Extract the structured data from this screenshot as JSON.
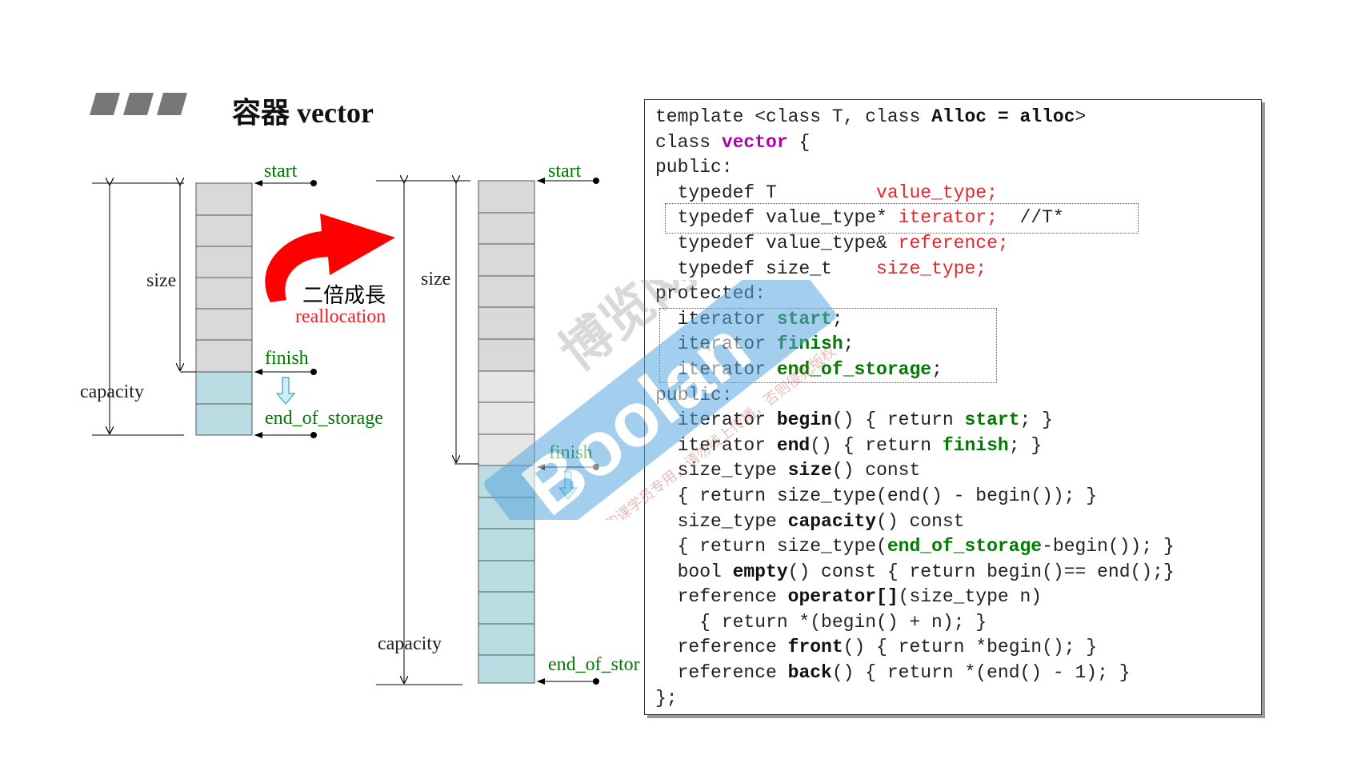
{
  "title": "容器 vector",
  "diagram": {
    "left": {
      "start": "start",
      "size": "size",
      "finish": "finish",
      "capacity": "capacity",
      "end_of_storage": "end_of_storage"
    },
    "arrow": {
      "cn": "二倍成長",
      "en": "reallocation"
    },
    "right": {
      "start": "start",
      "size": "size",
      "finish": "finish",
      "capacity": "capacity",
      "end_of_storage": "end_of_storage"
    }
  },
  "code": {
    "l1": [
      "template <class T, class ",
      "Alloc = alloc",
      ">"
    ],
    "l2": [
      "class ",
      "vector",
      " {"
    ],
    "l3": "public:",
    "l4": [
      "  typedef T         ",
      "value_type;"
    ],
    "l5": [
      "  typedef value_type* ",
      "iterator;",
      "  //T*"
    ],
    "l6": [
      "  typedef value_type& ",
      "reference;"
    ],
    "l7": [
      "  typedef size_t    ",
      "size_type;"
    ],
    "l8": "protected:",
    "l9": [
      "  iterator ",
      "start",
      ";"
    ],
    "l10": [
      "  iterator ",
      "finish",
      ";"
    ],
    "l11": [
      "  iterator ",
      "end_of_storage",
      ";"
    ],
    "l12": "public:",
    "l13": [
      "  iterator ",
      "begin",
      "() { return ",
      "start",
      "; }"
    ],
    "l14": [
      "  iterator ",
      "end",
      "() { return ",
      "finish",
      "; }"
    ],
    "l15": [
      "  size_type ",
      "size",
      "() const"
    ],
    "l16": "  { return size_type(end() - begin()); }",
    "l17": [
      "  size_type ",
      "capacity",
      "() const"
    ],
    "l18": [
      "  { return size_type(",
      "end_of_storage",
      "-begin()); }"
    ],
    "l19": [
      "  bool ",
      "empty",
      "() const { return begin()== end();}"
    ],
    "l20": [
      "  reference ",
      "operator[]",
      "(size_type n)"
    ],
    "l21": "    { return *(begin() + n); }",
    "l22": [
      "  reference ",
      "front",
      "() { return *begin(); }"
    ],
    "l23": [
      "  reference ",
      "back",
      "() { return *(end() - 1); }"
    ],
    "l24": "};"
  },
  "watermark": {
    "main": "Boolan",
    "cn": "博览网",
    "note": "本讲义仅供购课学员专用，请勿线上传播，否则侵犯版权"
  },
  "colors": {
    "red": "#e8252b",
    "green": "#007a00",
    "purple": "#b000b0",
    "used_cell": "#d9d9d9",
    "free_cell": "#b9dde2",
    "watermark": "#5aa7e0"
  }
}
